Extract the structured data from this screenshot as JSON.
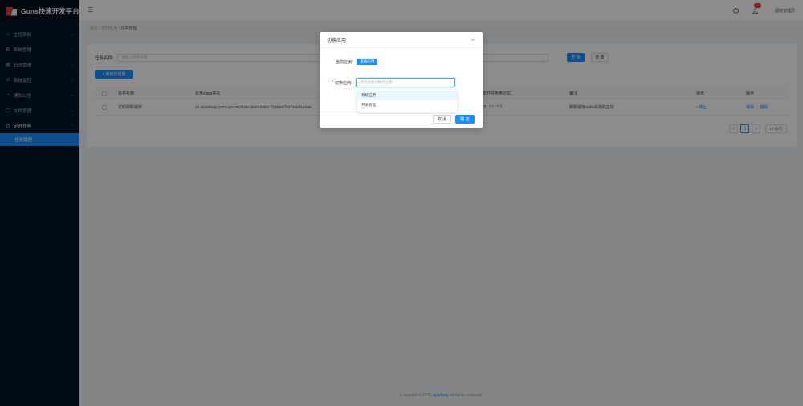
{
  "app": {
    "title": "Guns快速开发平台"
  },
  "sidebar": {
    "items": [
      {
        "label": "主控面板",
        "icon": "home-icon"
      },
      {
        "label": "系统管理",
        "icon": "gear-icon"
      },
      {
        "label": "日志管理",
        "icon": "log-icon"
      },
      {
        "label": "系统监控",
        "icon": "monitor-icon"
      },
      {
        "label": "通知公告",
        "icon": "notice-icon"
      },
      {
        "label": "文件管理",
        "icon": "file-icon"
      },
      {
        "label": "定时任务",
        "icon": "clock-icon"
      }
    ],
    "active_sub": "任务管理"
  },
  "header": {
    "notification_count": "10",
    "user": "超级管理员"
  },
  "breadcrumb": {
    "home": "首页",
    "parent": "定时任务",
    "current": "任务管理",
    "sep": "/"
  },
  "search": {
    "label": "任务名称:",
    "placeholder": "请输入任务名称",
    "query_label": "查 询",
    "reset_label": "重 置"
  },
  "add_button": {
    "label": "+ 新增定时器"
  },
  "table": {
    "headers": [
      "任务名称",
      "任务class类名",
      "定时任务表达式",
      "备注",
      "状态",
      "操作"
    ],
    "rows": [
      {
        "name": "定时刷新缓存",
        "class": "cn.stylefeng.guns.sys.modular.timer.tasks.SystemOutTaskRunner",
        "cron": "0/1 * * * * ?",
        "remark": "刷新缓存redis系统的生效",
        "status": "• 停止",
        "edit": "编辑",
        "op_sep": "|",
        "delete": "删除"
      }
    ]
  },
  "pagination": {
    "prev": "<",
    "current": "1",
    "next": ">",
    "size": "10 条/页"
  },
  "footer": {
    "prefix": "Copyright © 2020",
    "author": "stylefeng",
    "suffix": "All rights reserved."
  },
  "modal": {
    "title": "切换应用",
    "current_label": "当前应用:",
    "current_value": "系统应用",
    "switch_label": "切换应用:",
    "required_mark": "*",
    "placeholder": "请选择要切换的应用",
    "options": [
      "系统应用",
      "开发管理"
    ],
    "cancel": "取 消",
    "ok": "确 定"
  },
  "colors": {
    "primary": "#1890ff",
    "sidebar": "#001529",
    "danger": "#f5222d"
  }
}
